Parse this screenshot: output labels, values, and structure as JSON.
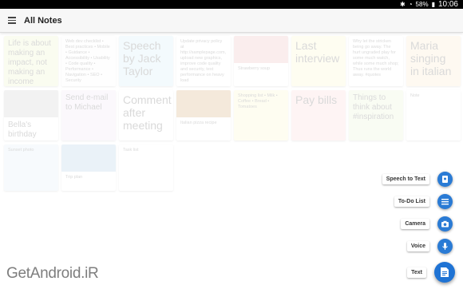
{
  "status_bar": {
    "battery": "58%",
    "time": "10:06"
  },
  "app_bar": {
    "title": "All Notes"
  },
  "notes": [
    {
      "text": "Life is about making an impact, not making an income #quotes"
    },
    {
      "text": "Web dev checklist • Best practices • Mobile • Guidance • Accessibility • Usability • Code quality • Performance • Navigation • SEO • Security"
    },
    {
      "text": "Speech by Jack Taylor"
    },
    {
      "text": "Update privacy policy at http://samplepage.com, upload new graphics, improve code quality and security, test performance on heavy load"
    },
    {
      "text": "Strawberry soup"
    },
    {
      "text": "Last interview"
    },
    {
      "text": "Why let the stricken being go away. The hurt ungraded play for some much watch, while some much shop; Thus runs the world away. #quotes"
    },
    {
      "text": "Maria singing in italian"
    },
    {
      "text": "Bella's birthday"
    },
    {
      "text": "Send e-mail to Michael"
    },
    {
      "text": "Comment after meeting"
    },
    {
      "text": "Italian pizza recipe"
    },
    {
      "text": "Shopping list • Milk • Coffee • Bread • Tomatoes"
    },
    {
      "text": "Pay bills"
    },
    {
      "text": "Things to think about #inspiration"
    },
    {
      "text": "Note"
    },
    {
      "text": "Sunset photo"
    },
    {
      "text": "Trip plan"
    },
    {
      "text": "Task list"
    }
  ],
  "speed_dial": {
    "items": [
      {
        "label": "Speech to Text",
        "icon": "speech-to-text-icon"
      },
      {
        "label": "To-Do List",
        "icon": "list-icon"
      },
      {
        "label": "Camera",
        "icon": "camera-icon"
      },
      {
        "label": "Voice",
        "icon": "microphone-icon"
      },
      {
        "label": "Text",
        "icon": "text-note-icon"
      }
    ]
  },
  "watermark": "GetAndroid.iR"
}
